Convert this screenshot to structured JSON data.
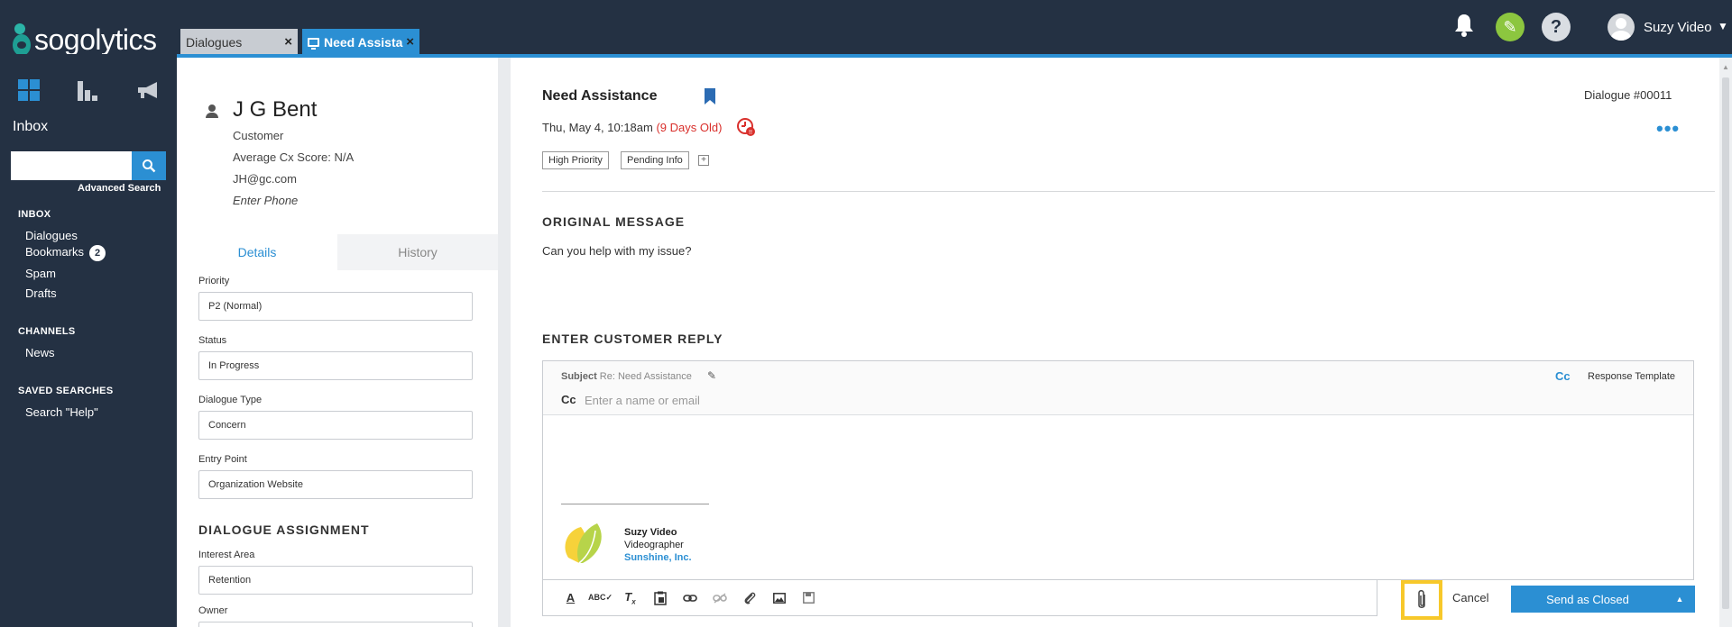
{
  "app": {
    "logo_text": "sogolytics"
  },
  "tabs": [
    {
      "label": "Dialogues"
    },
    {
      "label": "Need Assistance"
    }
  ],
  "header": {
    "user_name": "Suzy Video"
  },
  "nav": {
    "inbox_title": "Inbox",
    "search_placeholder": "",
    "advanced_search": "Advanced Search",
    "sections": {
      "inbox": "INBOX",
      "channels": "CHANNELS",
      "saved": "SAVED SEARCHES"
    },
    "inbox_items": [
      "Dialogues",
      "Bookmarks",
      "Spam",
      "Drafts"
    ],
    "bookmarks_count": "2",
    "channel_items": [
      "News"
    ],
    "saved_items": [
      "Search \"Help\""
    ]
  },
  "customer": {
    "name": "J G Bent",
    "role": "Customer",
    "cx_score": "Average Cx Score: N/A",
    "email": "JH@gc.com",
    "phone_placeholder": "Enter Phone"
  },
  "panel_tabs": {
    "details": "Details",
    "history": "History"
  },
  "fields": {
    "priority_label": "Priority",
    "priority_value": "P2 (Normal)",
    "status_label": "Status",
    "status_value": "In Progress",
    "type_label": "Dialogue Type",
    "type_value": "Concern",
    "entry_label": "Entry Point",
    "entry_value": "Organization Website",
    "assignment_head": "DIALOGUE ASSIGNMENT",
    "interest_label": "Interest Area",
    "interest_value": "Retention",
    "owner_label": "Owner"
  },
  "dialogue": {
    "title": "Need Assistance",
    "number": "Dialogue #00011",
    "date": "Thu, May 4, 10:18am",
    "age": "(9 Days Old)",
    "tags": [
      "High Priority",
      "Pending Info"
    ],
    "tag_add": "+",
    "more": "•••",
    "original_head": "ORIGINAL MESSAGE",
    "original_message": "Can you help with my issue?",
    "reply_head": "ENTER CUSTOMER REPLY"
  },
  "reply": {
    "subject_label": "Subject",
    "subject_value": "Re: Need Assistance",
    "cc_link": "Cc",
    "response_template": "Response Template",
    "cc_label": "Cc",
    "cc_placeholder": "Enter a name or email",
    "signature": {
      "name": "Suzy Video",
      "role": "Videographer",
      "company": "Sunshine, Inc."
    }
  },
  "actions": {
    "cancel": "Cancel",
    "send": "Send as Closed",
    "send_caret": "▲"
  },
  "toolbar_icons": [
    "font-color-icon",
    "spellcheck-icon",
    "clear-format-icon",
    "paste-icon",
    "link-icon",
    "unlink-icon",
    "attachment-icon",
    "image-icon",
    "save-icon"
  ],
  "colors": {
    "nav_bg": "#243143",
    "accent": "#2b8fd3",
    "brand_green": "#8cc63f",
    "alert_red": "#d9302c",
    "highlight": "#f7c82a"
  }
}
